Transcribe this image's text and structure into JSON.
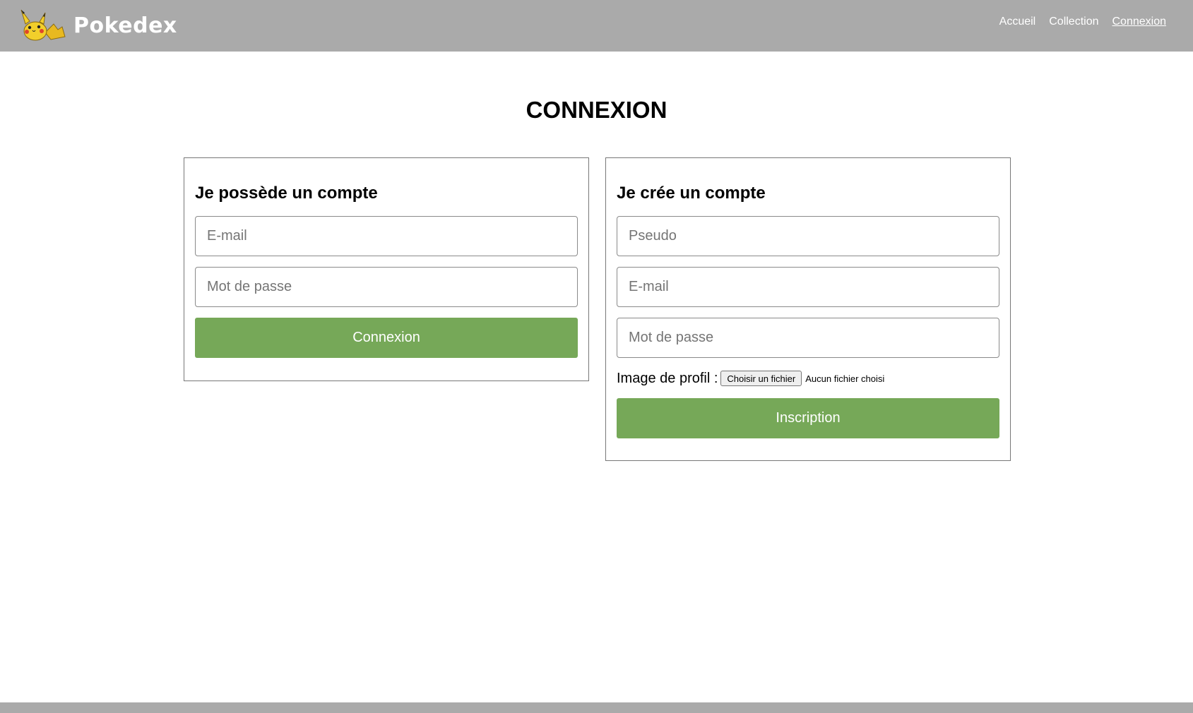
{
  "header": {
    "brand": "Pokedex",
    "logo_icon": "pikachu-logo-icon",
    "nav": [
      {
        "label": "Accueil",
        "active": false
      },
      {
        "label": "Collection",
        "active": false
      },
      {
        "label": "Connexion",
        "active": true
      }
    ]
  },
  "page": {
    "title": "CONNEXION"
  },
  "login": {
    "title": "Je possède un compte",
    "email_placeholder": "E-mail",
    "password_placeholder": "Mot de passe",
    "submit_label": "Connexion"
  },
  "signup": {
    "title": "Je crée un compte",
    "pseudo_placeholder": "Pseudo",
    "email_placeholder": "E-mail",
    "password_placeholder": "Mot de passe",
    "file_label": "Image de profil :",
    "file_button": "Choisir un fichier",
    "file_status": "Aucun fichier choisi",
    "submit_label": "Inscription"
  },
  "colors": {
    "header_bg": "#aaaaaa",
    "button_green": "#76a858",
    "nav_text": "#ffffff"
  }
}
